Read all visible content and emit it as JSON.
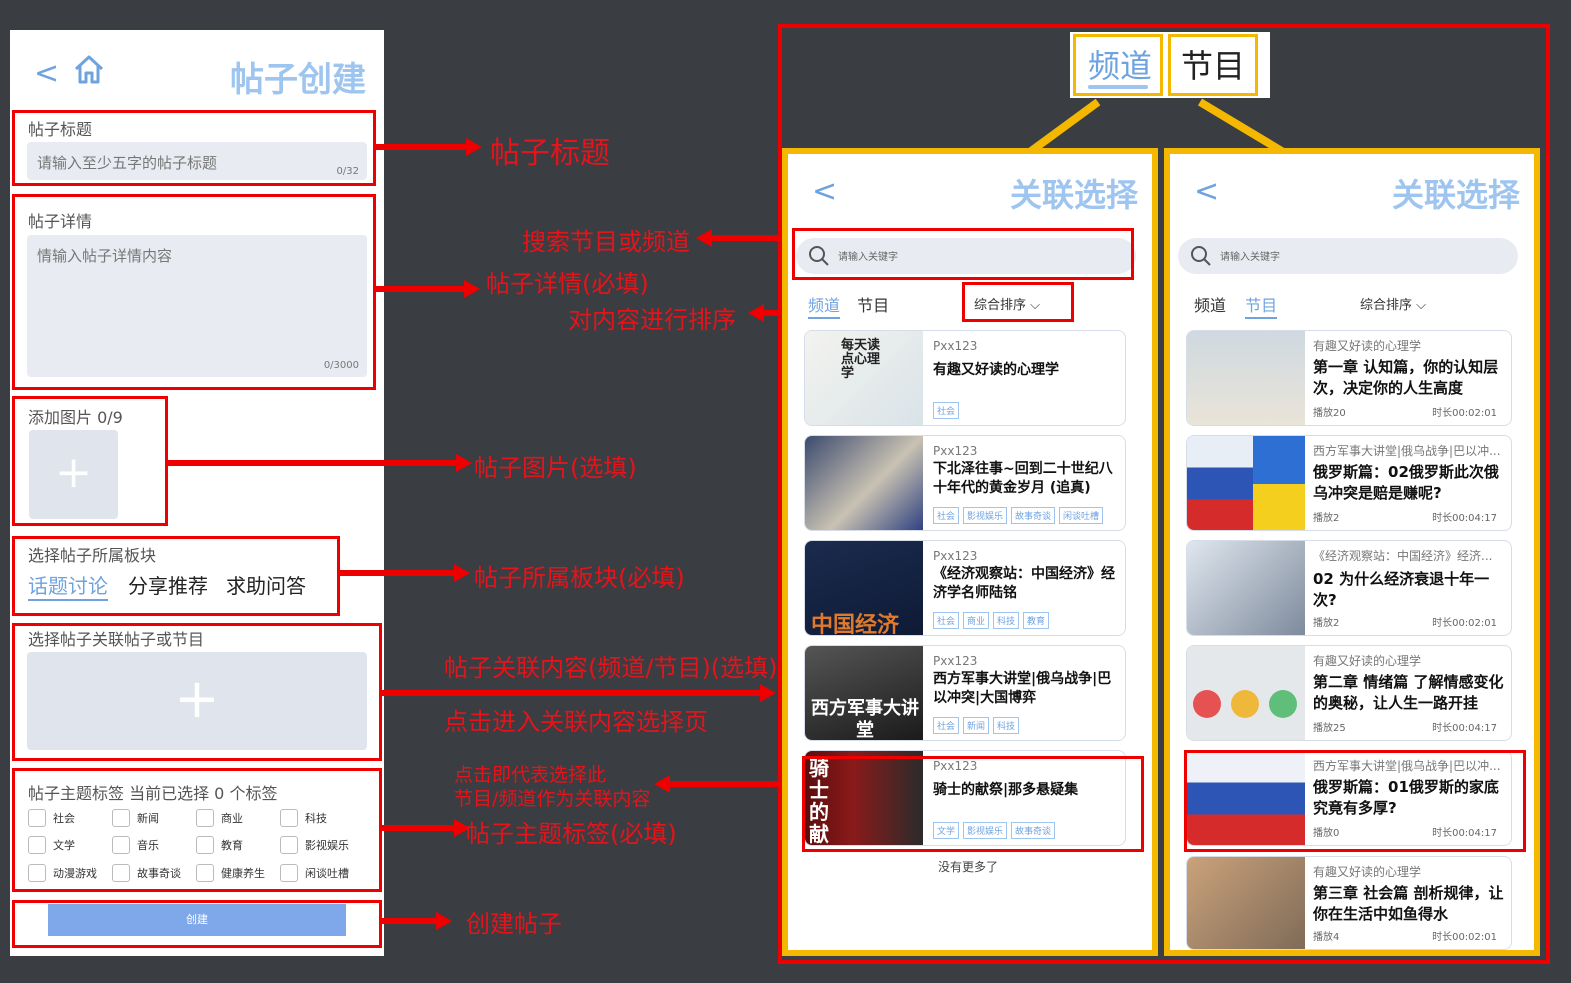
{
  "left_phone": {
    "title": "帖子创建",
    "title_field": {
      "label": "帖子标题",
      "placeholder": "请输入至少五字的帖子标题",
      "counter": "0/32"
    },
    "detail_field": {
      "label": "帖子详情",
      "placeholder": "情输入帖子详情内容",
      "counter": "0/3000"
    },
    "images": {
      "label": "添加图片 0/9"
    },
    "section": {
      "label": "选择帖子所属板块",
      "options": [
        "话题讨论",
        "分享推荐",
        "求助问答"
      ]
    },
    "relation": {
      "label": "选择帖子关联帖子或节目"
    },
    "tags": {
      "label": "帖子主题标签 当前已选择 0 个标签",
      "rows": [
        [
          "社会",
          "新闻",
          "商业",
          "科技"
        ],
        [
          "文学",
          "音乐",
          "教育",
          "影视娱乐"
        ],
        [
          "动漫游戏",
          "故事奇谈",
          "健康养生",
          "闲谈吐槽"
        ]
      ]
    },
    "create_button": "创建"
  },
  "annotations": {
    "post_title": "帖子标题",
    "post_detail": "帖子详情(必填)",
    "post_image": "帖子图片(选填)",
    "post_section": "帖子所属板块(必填)",
    "post_related": "帖子关联内容(频道/节目)(选填)",
    "click_enter": "点击进入关联内容选择页",
    "post_tags": "帖子主题标签(必填)",
    "create_post": "创建帖子",
    "search_hint": "搜索节目或频道",
    "sort_hint": "对内容进行排序",
    "select_hint_1": "点击即代表选择此",
    "select_hint_2": "节目/频道作为关联内容"
  },
  "top_tabs": {
    "channel": "频道",
    "program": "节目"
  },
  "channel_screen": {
    "title": "关联选择",
    "search_placeholder": "请输入关键字",
    "tabs": [
      "频道",
      "节目"
    ],
    "sort": "综合排序",
    "items": [
      {
        "author": "Pxx123",
        "title": "有趣又好读的心理学",
        "tags": [
          "社会"
        ],
        "thumb_text": "每天读点心理学"
      },
      {
        "author": "Pxx123",
        "title": "下北泽往事~回到二十世纪八十年代的黄金岁月 (追真)",
        "tags": [
          "社会",
          "影视娱乐",
          "故事奇谈",
          "闲谈吐槽"
        ],
        "thumb_text": ""
      },
      {
        "author": "Pxx123",
        "title": "《经济观察站：中国经济》经济学名师陆铭",
        "tags": [
          "社会",
          "商业",
          "科技",
          "教育"
        ],
        "thumb_text": "中国经济"
      },
      {
        "author": "Pxx123",
        "title": "西方军事大讲堂|俄乌战争|巴以冲突|大国博弈",
        "tags": [
          "社会",
          "新闻",
          "科技"
        ],
        "thumb_text": "西方军事大讲堂"
      },
      {
        "author": "Pxx123",
        "title": "骑士的献祭|那多悬疑集",
        "tags": [
          "文学",
          "影视娱乐",
          "故事奇谈"
        ],
        "thumb_text": "骑士的献祭"
      }
    ],
    "footer": "没有更多了"
  },
  "program_screen": {
    "title": "关联选择",
    "search_placeholder": "请输入关键字",
    "tabs": [
      "频道",
      "节目"
    ],
    "sort": "综合排序",
    "items": [
      {
        "channel": "有趣又好读的心理学",
        "title": "第一章 认知篇，你的认知层次，决定你的人生高度",
        "plays": "播放20",
        "duration": "时长00:02:01"
      },
      {
        "channel": "西方军事大讲堂|俄乌战争|巴以冲...",
        "title": "俄罗斯篇：02俄罗斯此次俄乌冲突是赔是赚呢?",
        "plays": "播放2",
        "duration": "时长00:04:17"
      },
      {
        "channel": "《经济观察站：中国经济》经济...",
        "title": "02 为什么经济衰退十年一次?",
        "plays": "播放2",
        "duration": "时长00:02:01"
      },
      {
        "channel": "有趣又好读的心理学",
        "title": "第二章 情绪篇 了解情感变化的奥秘，让人生一路开挂",
        "plays": "播放25",
        "duration": "时长00:04:17"
      },
      {
        "channel": "西方军事大讲堂|俄乌战争|巴以冲...",
        "title": "俄罗斯篇：01俄罗斯的家底究竟有多厚?",
        "plays": "播放0",
        "duration": "时长00:04:17"
      },
      {
        "channel": "有趣又好读的心理学",
        "title": "第三章 社会篇 剖析规律，让你在生活中如鱼得水",
        "plays": "播放4",
        "duration": "时长00:02:01"
      }
    ]
  },
  "colors": {
    "annotation_red": "#e5141b",
    "highlight_yellow": "#f5b800",
    "accent_blue": "#6fa3e0",
    "background": "#3a3d41"
  }
}
